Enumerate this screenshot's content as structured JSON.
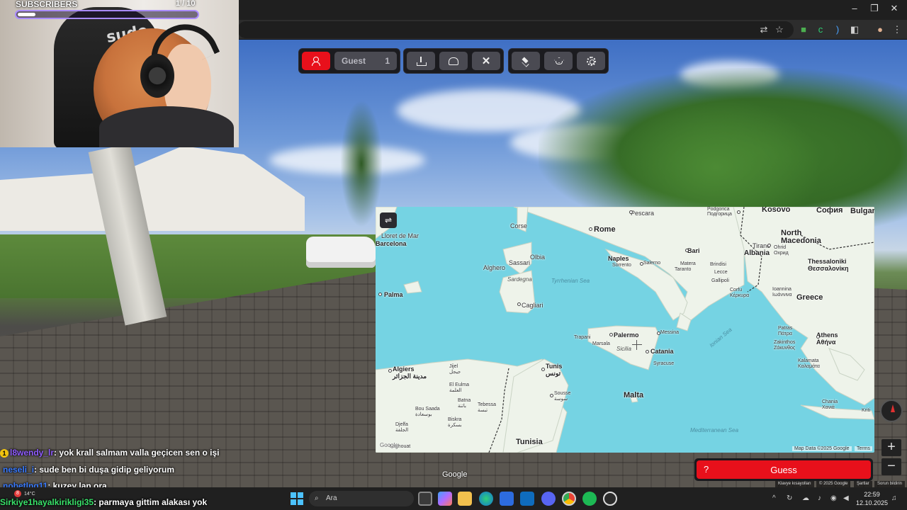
{
  "overlay": {
    "subscribers_label": "SUBSCRIBERS",
    "subscribers_count": "1 / 10",
    "subscribers_progress": 0.1,
    "chair_logo": "sude"
  },
  "game_toolbar": {
    "guest_label": "Guest",
    "guest_count": "1"
  },
  "map": {
    "labels": [
      {
        "text": "Pescara",
        "cls": ""
      },
      {
        "text": "Podgorica\nПодгорица",
        "cls": ""
      },
      {
        "text": "Kosovo",
        "cls": "big"
      },
      {
        "text": "София",
        "cls": "big"
      },
      {
        "text": "Bulgar",
        "cls": "big"
      },
      {
        "text": "Rome",
        "cls": "big"
      },
      {
        "text": "North\nMacedonia",
        "cls": "big"
      },
      {
        "text": "Lloret de Mar",
        "cls": ""
      },
      {
        "text": "Barcelona",
        "cls": "big"
      },
      {
        "text": "Corse",
        "cls": ""
      },
      {
        "text": "Bari",
        "cls": "big"
      },
      {
        "text": "Tirane",
        "cls": ""
      },
      {
        "text": "Albania",
        "cls": "big"
      },
      {
        "text": "Ohrid\nОхрид",
        "cls": ""
      },
      {
        "text": "Thessaloniki\nΘεσσαλονίκη",
        "cls": "big"
      },
      {
        "text": "Olbia",
        "cls": ""
      },
      {
        "text": "Sassari",
        "cls": ""
      },
      {
        "text": "Alghero",
        "cls": ""
      },
      {
        "text": "Naples",
        "cls": "big"
      },
      {
        "text": "Sorrento",
        "cls": ""
      },
      {
        "text": "Salerno",
        "cls": ""
      },
      {
        "text": "Matera",
        "cls": ""
      },
      {
        "text": "Brindisi",
        "cls": ""
      },
      {
        "text": "Lecce",
        "cls": ""
      },
      {
        "text": "Taranto",
        "cls": ""
      },
      {
        "text": "Gallipoli",
        "cls": ""
      },
      {
        "text": "Palma",
        "cls": "big"
      },
      {
        "text": "Sardegna",
        "cls": "sea"
      },
      {
        "text": "Tyrrhenian Sea",
        "cls": "sea"
      },
      {
        "text": "Corfu\nΚέρκυρα",
        "cls": ""
      },
      {
        "text": "Ioannina\nΙωάννινα",
        "cls": ""
      },
      {
        "text": "Greece",
        "cls": "big"
      },
      {
        "text": "Cagliari",
        "cls": ""
      },
      {
        "text": "Ionian Sea",
        "cls": "sea"
      },
      {
        "text": "Messina",
        "cls": ""
      },
      {
        "text": "Palermo",
        "cls": "big"
      },
      {
        "text": "Trapani",
        "cls": ""
      },
      {
        "text": "Marsala",
        "cls": ""
      },
      {
        "text": "Sicilia",
        "cls": "sea"
      },
      {
        "text": "Catania",
        "cls": "big"
      },
      {
        "text": "Patras\nΠάτρα",
        "cls": ""
      },
      {
        "text": "Athens\nΑθήνα",
        "cls": "big"
      },
      {
        "text": "Zakinthos\nΖάκυνθος",
        "cls": ""
      },
      {
        "text": "Syracuse",
        "cls": ""
      },
      {
        "text": "Kalamata\nΚαλαμάτα",
        "cls": ""
      },
      {
        "text": "Algiers\nمدينة الجزائر",
        "cls": "big"
      },
      {
        "text": "Jijel\nجيجل",
        "cls": ""
      },
      {
        "text": "Tunis\nتونس",
        "cls": "big"
      },
      {
        "text": "El Eulma\nالعلمة",
        "cls": ""
      },
      {
        "text": "Batna\nباتنة",
        "cls": ""
      },
      {
        "text": "Tebessa\nتبسة",
        "cls": ""
      },
      {
        "text": "Sousse\nسوسة",
        "cls": ""
      },
      {
        "text": "Malta",
        "cls": "big"
      },
      {
        "text": "Bou Saada\nبوسعادة",
        "cls": ""
      },
      {
        "text": "Biskra\nبسكرة",
        "cls": ""
      },
      {
        "text": "Djelfa\nالجلفة",
        "cls": ""
      },
      {
        "text": "Laghouat",
        "cls": ""
      },
      {
        "text": "Tunisia",
        "cls": "big"
      },
      {
        "text": "Chania\nΧανιά",
        "cls": ""
      },
      {
        "text": "Kriti",
        "cls": ""
      },
      {
        "text": "Mediterranean Sea",
        "cls": "sea"
      }
    ],
    "map_data": "Map Data ©2025 Google",
    "terms": "Terms",
    "google_logo": "Google"
  },
  "streetview": {
    "google_watermark": "Google",
    "zoom_in": "+",
    "zoom_out": "−",
    "attribution": [
      "Klavye kısayolları",
      "© 2025 Google",
      "Şartlar",
      "Sorun bildirin"
    ]
  },
  "guess": {
    "help": "?",
    "label": "Guess"
  },
  "chat": [
    {
      "user": "l8wendy_lr",
      "user_color": "#8f5cff",
      "msg": ": yok krall salmam valla geçicen sen o işi",
      "badge": "1"
    },
    {
      "user": "neseli_i",
      "user_color": "#3a7bff",
      "msg": ": sude ben bi duşa gidip geliyorum",
      "badge": ""
    },
    {
      "user": "nobetlng11",
      "user_color": "#3a7bff",
      "msg": ": kuzey lan ora",
      "badge": ""
    },
    {
      "user": "Sirkiye1hayalkirikligi35",
      "user_color": "#39e36a",
      "msg": ": parmaya gittim alakası yok",
      "badge": ""
    }
  ],
  "taskbar": {
    "search_placeholder": "Ara",
    "weather": "14°C",
    "weather_badge": "8",
    "time": "22:59",
    "date": "12.10.2025"
  },
  "colors": {
    "accent_red": "#e8101b",
    "sea": "#75d3e3",
    "land": "#eef3ea",
    "subs_border": "#a98bff"
  }
}
